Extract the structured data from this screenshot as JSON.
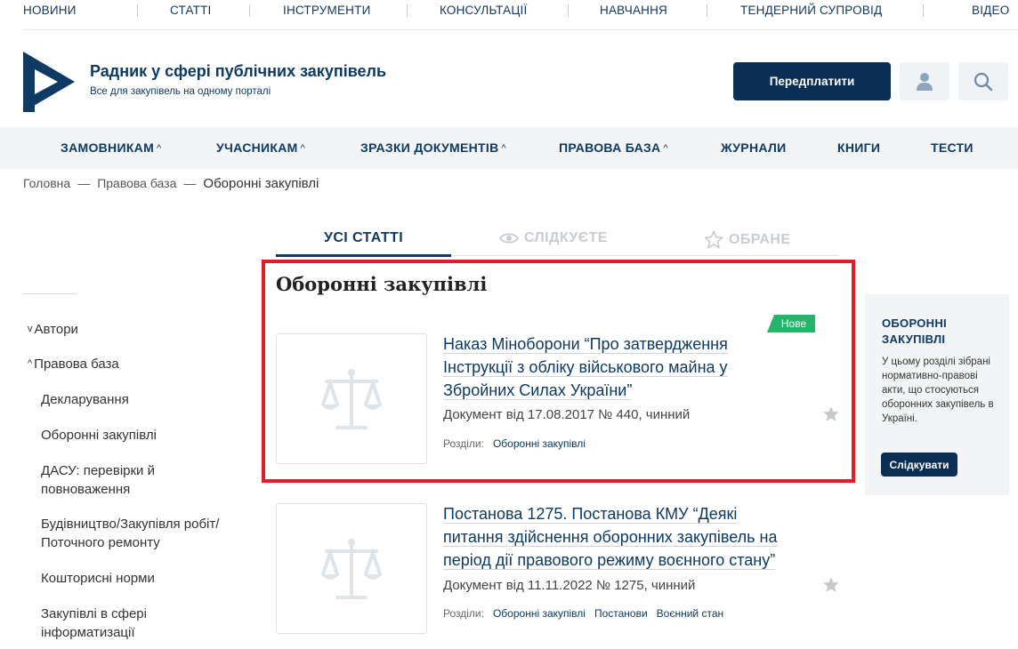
{
  "top_nav": [
    "НОВИНИ",
    "СТАТТІ",
    "ІНСТРУМЕНТИ",
    "КОНСУЛЬТАЦІЇ",
    "НАВЧАННЯ",
    "ТЕНДЕРНИЙ СУПРОВІД",
    "ВІДЕО"
  ],
  "header": {
    "title": "Радник у сфері публічних закупівель",
    "subtitle": "Все для закупівель на одному порталі",
    "subscribe_label": "Передплатити",
    "user_icon": "user-icon",
    "search_icon": "search-icon"
  },
  "main_nav": {
    "customers": "ЗАМОВНИКАМ",
    "participants": "УЧАСНИКАМ",
    "doc_samples": "ЗРАЗКИ ДОКУМЕНТІВ",
    "legal_base": "ПРАВОВА БАЗА",
    "journals": "ЖУРНАЛИ",
    "books": "КНИГИ",
    "tests": "ТЕСТИ"
  },
  "breadcrumb": {
    "home": "Головна",
    "legal_base": "Правова база",
    "current": "Оборонні закупівлі"
  },
  "tabs": {
    "all": "УСІ СТАТТІ",
    "following": "СЛІДКУЄТЕ",
    "favorites": "ОБРАНЕ"
  },
  "sidebar": {
    "authors": "Автори",
    "legal_base": "Правова база",
    "items": [
      "Декларування",
      "Оборонні закупівлі",
      "ДАСУ: перевірки й",
      "повноваження",
      "Будівництво/Закупівля робіт/",
      "Поточного ремонту",
      "Кошторисні норми",
      "Закупівлі в сфері",
      "інформатизації"
    ]
  },
  "section": {
    "title": "Оборонні закупівлі"
  },
  "articles": [
    {
      "badge": "Нове",
      "title_lines": [
        "Наказ Міноборони “Про затвердження",
        "Інструкції з обліку військового майна у",
        "Збройних Силах України”"
      ],
      "meta": "Документ від 17.08.2017  № 440, чинний",
      "sections_label": "Розділи:",
      "tags": [
        "Оборонні закупівлі"
      ]
    },
    {
      "title_lines": [
        "Постанова 1275. Постанова КМУ “Деякі",
        "питання здійснення оборонних закупівель на",
        "період дії правового режиму воєнного стану”"
      ],
      "meta": "Документ від 11.11.2022 № 1275, чинний",
      "sections_label": "Розділи:",
      "tags": [
        "Оборонні закупівлі",
        "Постанови",
        "Воєнний стан"
      ]
    }
  ],
  "info_panel": {
    "title_line1": "ОБОРОННІ",
    "title_line2": "ЗАКУПІВЛІ",
    "text": "У цьому розділі зібрані нормативно-правові акти, що стосуються оборонних закупівель в Україні.",
    "follow_label": "Слідкувати"
  },
  "colors": {
    "brand_navy": "#0b2e55",
    "link_navy": "#0e3a63",
    "badge_green": "#27b56b",
    "highlight_red": "#e01e2a"
  }
}
